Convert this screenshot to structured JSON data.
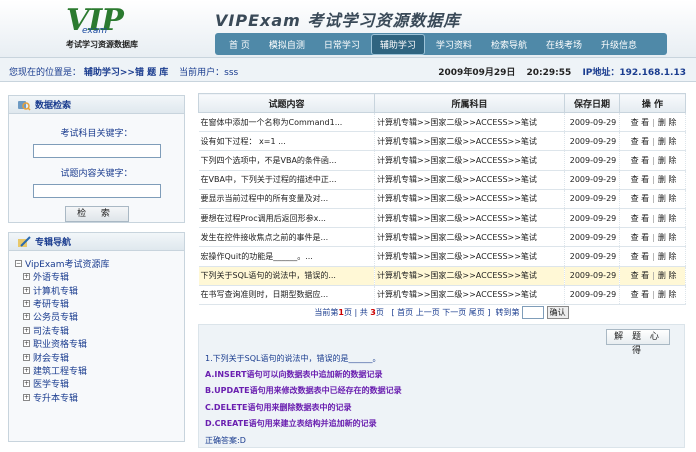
{
  "header": {
    "logo_text": "VIP",
    "logo_exam": "exam",
    "logo_sub": "考试学习资源数据库",
    "site_title": "VIPExam 考试学习资源数据库",
    "nav": [
      {
        "label": "首  页",
        "active": false
      },
      {
        "label": "模拟自测",
        "active": false
      },
      {
        "label": "日常学习",
        "active": false
      },
      {
        "label": "辅助学习",
        "active": true
      },
      {
        "label": "学习资料",
        "active": false
      },
      {
        "label": "检索导航",
        "active": false
      },
      {
        "label": "在线考场",
        "active": false
      },
      {
        "label": "升级信息",
        "active": false
      }
    ]
  },
  "locbar": {
    "location_label": "您现在的位置是：",
    "path": "辅助学习>>错  题  库",
    "user_label": "当前用户：sss",
    "date": "2009年09月29日",
    "time": "20:29:55",
    "ip": "IP地址：192.168.1.13"
  },
  "search_panel": {
    "title": "数据检索",
    "label_subject": "考试科目关键字：",
    "label_content": "试题内容关键字：",
    "button": "检 索",
    "subject_value": "",
    "content_value": ""
  },
  "nav_panel": {
    "title": "专辑导航",
    "root": "VipExam考试资源库",
    "items": [
      "外语专辑",
      "计算机专辑",
      "考研专辑",
      "公务员专辑",
      "司法专辑",
      "职业资格专辑",
      "财会专辑",
      "建筑工程专辑",
      "医学专辑",
      "专升本专辑"
    ]
  },
  "table": {
    "headers": [
      "试题内容",
      "所属科目",
      "保存日期",
      "操  作"
    ],
    "rows": [
      {
        "content": "在窗体中添加一个名称为Command1...",
        "subject": "计算机专辑>>国家二级>>ACCESS>>笔试",
        "date": "2009-09-29",
        "highlight": false
      },
      {
        "content": "设有如下过程：  x=1 ...",
        "subject": "计算机专辑>>国家二级>>ACCESS>>笔试",
        "date": "2009-09-29",
        "highlight": false
      },
      {
        "content": "下列四个选项中，不是VBA的条件函...",
        "subject": "计算机专辑>>国家二级>>ACCESS>>笔试",
        "date": "2009-09-29",
        "highlight": false
      },
      {
        "content": "在VBA中，下列关于过程的描述中正...",
        "subject": "计算机专辑>>国家二级>>ACCESS>>笔试",
        "date": "2009-09-29",
        "highlight": false
      },
      {
        "content": "要显示当前过程中的所有变量及对...",
        "subject": "计算机专辑>>国家二级>>ACCESS>>笔试",
        "date": "2009-09-29",
        "highlight": false
      },
      {
        "content": "要想在过程Proc调用后返回形参x...",
        "subject": "计算机专辑>>国家二级>>ACCESS>>笔试",
        "date": "2009-09-29",
        "highlight": false
      },
      {
        "content": "发生在控件接收焦点之前的事件是...",
        "subject": "计算机专辑>>国家二级>>ACCESS>>笔试",
        "date": "2009-09-29",
        "highlight": false
      },
      {
        "content": "宏操作Quit的功能是______。...",
        "subject": "计算机专辑>>国家二级>>ACCESS>>笔试",
        "date": "2009-09-29",
        "highlight": false
      },
      {
        "content": "下列关于SQL语句的说法中，错误的...",
        "subject": "计算机专辑>>国家二级>>ACCESS>>笔试",
        "date": "2009-09-29",
        "highlight": true
      },
      {
        "content": "在书写查询准则时，日期型数据应...",
        "subject": "计算机专辑>>国家二级>>ACCESS>>笔试",
        "date": "2009-09-29",
        "highlight": false
      }
    ],
    "op_view": "查 看",
    "op_sep": "|",
    "op_delete": "删 除"
  },
  "pager": {
    "prefix": "当前第",
    "current": "1",
    "mid": "页 | 共",
    "total": "3",
    "suffix": "页",
    "links": "[ 首页 上一页 下一页 尾页 ]",
    "jump_label": "转到第",
    "jump_value": "",
    "confirm": "确认"
  },
  "answer": {
    "head": "解 题 心 得",
    "question": "1.下列关于SQL语句的说法中，错误的是______。",
    "options": [
      "A.INSERT语句可以向数据表中追加新的数据记录",
      "B.UPDATE语句用来修改数据表中已经存在的数据记录",
      "C.DELETE语句用来删除数据表中的记录",
      "D.CREATE语句用来建立表结构并追加新的记录"
    ],
    "correct": "正确答案:D"
  }
}
